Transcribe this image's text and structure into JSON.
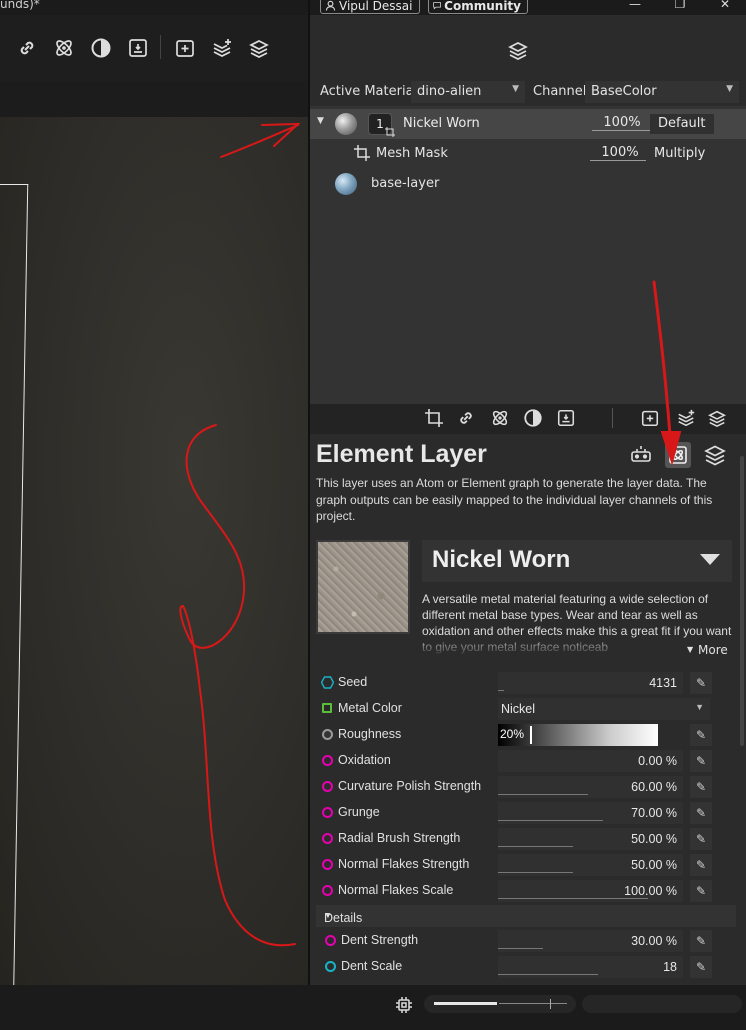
{
  "window": {
    "title_fragment": "unds)*",
    "user_name": "Vipul Dessai",
    "community_label": "Community"
  },
  "material_bar": {
    "active_material_label": "Active Material",
    "active_material_value": "dino-alien",
    "channel_label": "Channel",
    "channel_value": "BaseColor"
  },
  "layers": [
    {
      "name": "Nickel Worn",
      "index": "1",
      "opacity": "100%",
      "blend": "Default",
      "selected": true
    },
    {
      "name": "Mesh Mask",
      "opacity": "100%",
      "blend": "Multiply"
    },
    {
      "name": "base-layer"
    }
  ],
  "properties": {
    "title": "Element Layer",
    "description": "This layer uses an Atom or Element graph to generate the layer data. The graph outputs can be easily mapped to the individual layer channels of this project.",
    "material_name": "Nickel Worn",
    "material_description": "A versatile metal material featuring a wide selection of different metal base types. Wear and tear as well as oxidation and other effects make this a great fit if you want to give your metal surface noticeab",
    "more_label": "More",
    "params": [
      {
        "name": "Seed",
        "value": "4131"
      },
      {
        "name": "Metal Color",
        "value": "Nickel"
      },
      {
        "name": "Roughness",
        "value": "20%"
      },
      {
        "name": "Oxidation",
        "value": "0.00 %"
      },
      {
        "name": "Curvature Polish Strength",
        "value": "60.00 %"
      },
      {
        "name": "Grunge",
        "value": "70.00 %"
      },
      {
        "name": "Radial Brush Strength",
        "value": "50.00 %"
      },
      {
        "name": "Normal Flakes Strength",
        "value": "50.00 %"
      },
      {
        "name": "Normal Flakes Scale",
        "value": "100.00 %"
      }
    ],
    "details_label": "Details",
    "detail_params": [
      {
        "name": "Dent Strength",
        "value": "30.00 %"
      },
      {
        "name": "Dent Scale",
        "value": "18"
      }
    ]
  },
  "levels": {
    "roughness": 0.2,
    "oxidation": 0,
    "curvature_polish": 0.6,
    "grunge": 0.7,
    "radial_brush": 0.5,
    "normal_flakes_strength": 0.5,
    "normal_flakes_scale": 1.0,
    "dent_strength": 0.3,
    "brush_size_slider": 0.45
  },
  "icons": {
    "left_toolbar": [
      "link-icon",
      "atom-icon",
      "half-circle-icon",
      "image-export-icon",
      "add-layer-icon",
      "add-layers-icon",
      "layers-icon"
    ],
    "layer_tools": [
      "crop-mask-icon",
      "link-icon",
      "atom-icon",
      "half-circle-icon",
      "image-export-icon",
      "add-layer-icon",
      "add-layers-icon",
      "layers-icon"
    ],
    "element_header": [
      "robot-icon",
      "element-graph-icon",
      "layers-stack-icon"
    ]
  },
  "colors": {
    "annotation": "#d81818",
    "param_pink": "#e600b0",
    "param_cyan": "#19b3c8",
    "param_green": "#5bbf3a"
  }
}
